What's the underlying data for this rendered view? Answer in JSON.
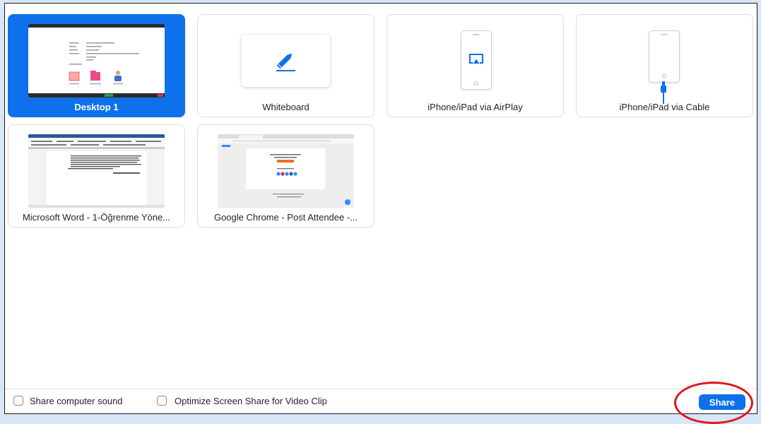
{
  "tiles": [
    {
      "label": "Desktop 1",
      "selected": true
    },
    {
      "label": "Whiteboard"
    },
    {
      "label": "iPhone/iPad via AirPlay"
    },
    {
      "label": "iPhone/iPad via Cable"
    },
    {
      "label": "Microsoft Word - 1-Öğrenme Yöne..."
    },
    {
      "label": "Google Chrome - Post Attendee -..."
    }
  ],
  "options": {
    "share_sound": {
      "label": "Share computer sound",
      "checked": false
    },
    "optimize_video": {
      "label": "Optimize Screen Share for Video Clip",
      "checked": false
    }
  },
  "share_button": {
    "label": "Share"
  },
  "colors": {
    "accent": "#0e71eb",
    "annotation": "#e0151d",
    "backdrop": "#d9e6f5"
  },
  "icons": {
    "whiteboard": "pencil-icon",
    "airplay": "airplay-icon",
    "cable": "lightning-cable-icon"
  }
}
